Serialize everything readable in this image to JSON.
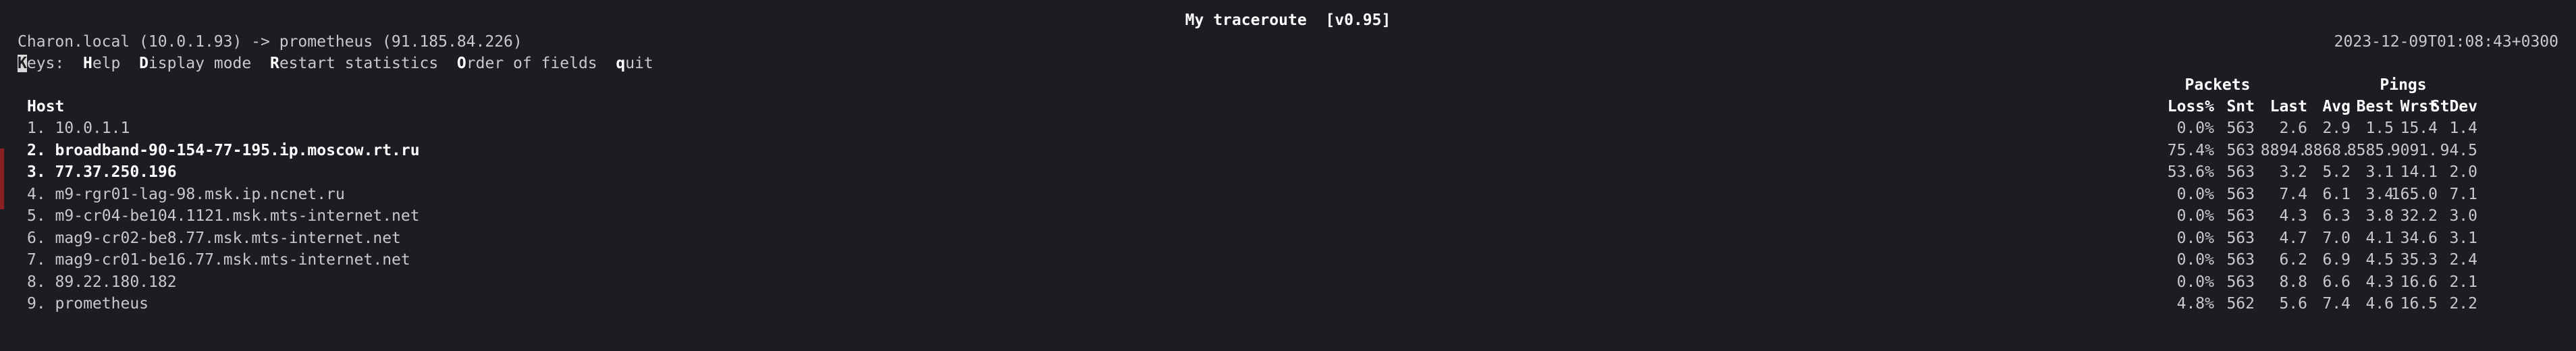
{
  "title": "My traceroute  [v0.95]",
  "host_info": "Charon.local (10.0.1.93) -> prometheus (91.185.84.226)",
  "datetime": "2023-12-09T01:08:43+0300",
  "keys": {
    "prefix_cursor": "K",
    "prefix_rest": "eys:",
    "items": [
      {
        "key": "H",
        "rest": "elp"
      },
      {
        "key": "D",
        "rest": "isplay mode"
      },
      {
        "key": "R",
        "rest": "estart statistics"
      },
      {
        "key": "O",
        "rest": "rder of fields"
      },
      {
        "key": "q",
        "rest": "uit"
      }
    ]
  },
  "headers": {
    "host": "Host",
    "packets": "Packets",
    "pings": "Pings",
    "columns": [
      "Loss%",
      "Snt",
      "Last",
      "Avg",
      "Best",
      "Wrst",
      "StDev"
    ]
  },
  "rows": [
    {
      "host": "1. 10.0.1.1",
      "bold": false,
      "values": [
        "0.0%",
        "563",
        "2.6",
        "2.9",
        "1.5",
        "15.4",
        "1.4"
      ]
    },
    {
      "host": "2. broadband-90-154-77-195.ip.moscow.rt.ru",
      "bold": true,
      "values": [
        "75.4%",
        "563",
        "8894.",
        "8868.",
        "8585.",
        "9091.",
        "94.5"
      ]
    },
    {
      "host": "3. 77.37.250.196",
      "bold": true,
      "values": [
        "53.6%",
        "563",
        "3.2",
        "5.2",
        "3.1",
        "14.1",
        "2.0"
      ]
    },
    {
      "host": "4. m9-rgr01-lag-98.msk.ip.ncnet.ru",
      "bold": false,
      "values": [
        "0.0%",
        "563",
        "7.4",
        "6.1",
        "3.4",
        "165.0",
        "7.1"
      ]
    },
    {
      "host": "5. m9-cr04-be104.1121.msk.mts-internet.net",
      "bold": false,
      "values": [
        "0.0%",
        "563",
        "4.3",
        "6.3",
        "3.8",
        "32.2",
        "3.0"
      ]
    },
    {
      "host": "6. mag9-cr02-be8.77.msk.mts-internet.net",
      "bold": false,
      "values": [
        "0.0%",
        "563",
        "4.7",
        "7.0",
        "4.1",
        "34.6",
        "3.1"
      ]
    },
    {
      "host": "7. mag9-cr01-be16.77.msk.mts-internet.net",
      "bold": false,
      "values": [
        "0.0%",
        "563",
        "6.2",
        "6.9",
        "4.5",
        "35.3",
        "2.4"
      ]
    },
    {
      "host": "8. 89.22.180.182",
      "bold": false,
      "values": [
        "0.0%",
        "563",
        "8.8",
        "6.6",
        "4.3",
        "16.6",
        "2.1"
      ]
    },
    {
      "host": "9. prometheus",
      "bold": false,
      "values": [
        "4.8%",
        "562",
        "5.6",
        "7.4",
        "4.6",
        "16.5",
        "2.2"
      ]
    }
  ]
}
